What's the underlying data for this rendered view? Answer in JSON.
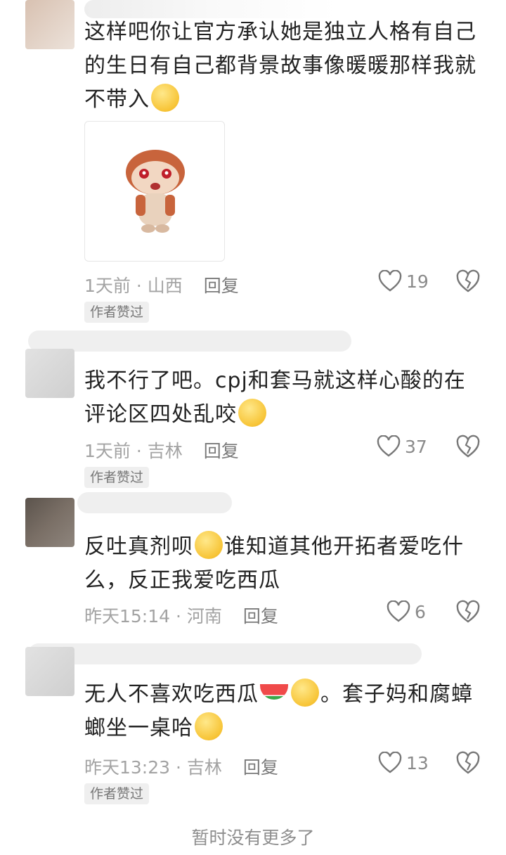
{
  "comments": [
    {
      "text_parts": [
        "这样吧你让官方承认她是独立人格有自己的生日有自己都背景故事像暖暖那样我就不带入"
      ],
      "meta": "1天前 · 山西",
      "reply_label": "回复",
      "likes": "19",
      "badge": "作者赞过"
    },
    {
      "text_parts": [
        "我不行了吧。cpj和套马就这样心酸的在评论区四处乱咬"
      ],
      "meta": "1天前 · 吉林",
      "reply_label": "回复",
      "likes": "37",
      "badge": "作者赞过"
    },
    {
      "text_parts": [
        "反吐真剂呗",
        "谁知道其他开拓者爱吃什么，反正我爱吃西瓜"
      ],
      "meta": "昨天15:14 · 河南",
      "reply_label": "回复",
      "likes": "6"
    },
    {
      "text_parts": [
        "无人不喜欢吃西瓜",
        "。套子妈和腐蟑螂坐一桌哈"
      ],
      "meta": "昨天13:23 · 吉林",
      "reply_label": "回复",
      "likes": "13",
      "badge": "作者赞过"
    }
  ],
  "footer": "暂时没有更多了",
  "icons": {
    "like": "heart-outline-icon",
    "dislike": "broken-heart-icon",
    "emoji": "smiley-emoji-icon",
    "sticker": "hamster-sticker"
  },
  "colors": {
    "text": "#222222",
    "meta": "#a3a3a3",
    "badge_bg": "#efefef"
  }
}
